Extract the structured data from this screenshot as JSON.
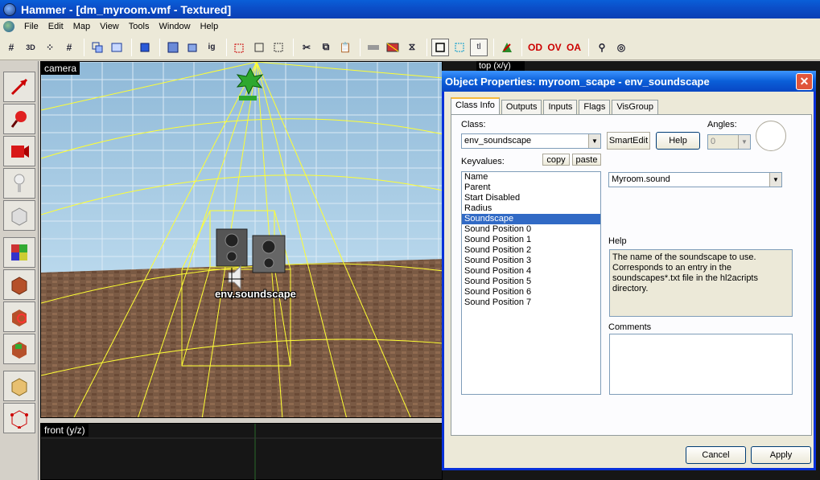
{
  "window": {
    "title": "Hammer - [dm_myroom.vmf - Textured]"
  },
  "menu": [
    "File",
    "Edit",
    "Map",
    "View",
    "Tools",
    "Window",
    "Help"
  ],
  "toolbar": {
    "buttons": [
      "grid-icon",
      "3d-grid-icon",
      "grid-dot-icon",
      "grid-hash-icon",
      "carve-icon",
      "group-icon",
      "ungroup-icon",
      "tie-icon",
      "ignore-group-icon",
      "hide-icon",
      "show-icon",
      "cut-icon",
      "copy-icon",
      "paste-icon",
      "blank-icon",
      "vertex-icon",
      "toggle-select-icon",
      "texture-lock-icon",
      "tl-icon",
      "decal-icon",
      "selection-icon",
      "cordon-icon",
      "entity-report-icon"
    ]
  },
  "viewports": {
    "camera": "camera",
    "front": "front (y/z)",
    "top": "top (x/y)"
  },
  "entity_label": "env.soundscape",
  "dialog": {
    "title": "Object Properties: myroom_scape - env_soundscape",
    "tabs": [
      "Class Info",
      "Outputs",
      "Inputs",
      "Flags",
      "VisGroup"
    ],
    "active_tab": "Class Info",
    "class_label": "Class:",
    "class_value": "env_soundscape",
    "smartedit_label": "SmartEdit",
    "help_button": "Help",
    "angles_label": "Angles:",
    "angles_value": "0",
    "keyvalues_label": "Keyvalues:",
    "copy_button": "copy",
    "paste_button": "paste",
    "keyvalues": [
      "Name",
      "Parent",
      "Start Disabled",
      "Radius",
      "Soundscape",
      "Sound Position 0",
      "Sound Position 1",
      "Sound Position 2",
      "Sound Position 3",
      "Sound Position 4",
      "Sound Position 5",
      "Sound Position 6",
      "Sound Position 7"
    ],
    "selected_key": "Soundscape",
    "value_combo": "Myroom.sound",
    "help_title": "Help",
    "help_text": "The name of the soundscape to use. Corresponds to an entry in the soundscapes*.txt file in the hl2acripts directory.",
    "comments_label": "Comments",
    "cancel_button": "Cancel",
    "apply_button": "Apply"
  }
}
